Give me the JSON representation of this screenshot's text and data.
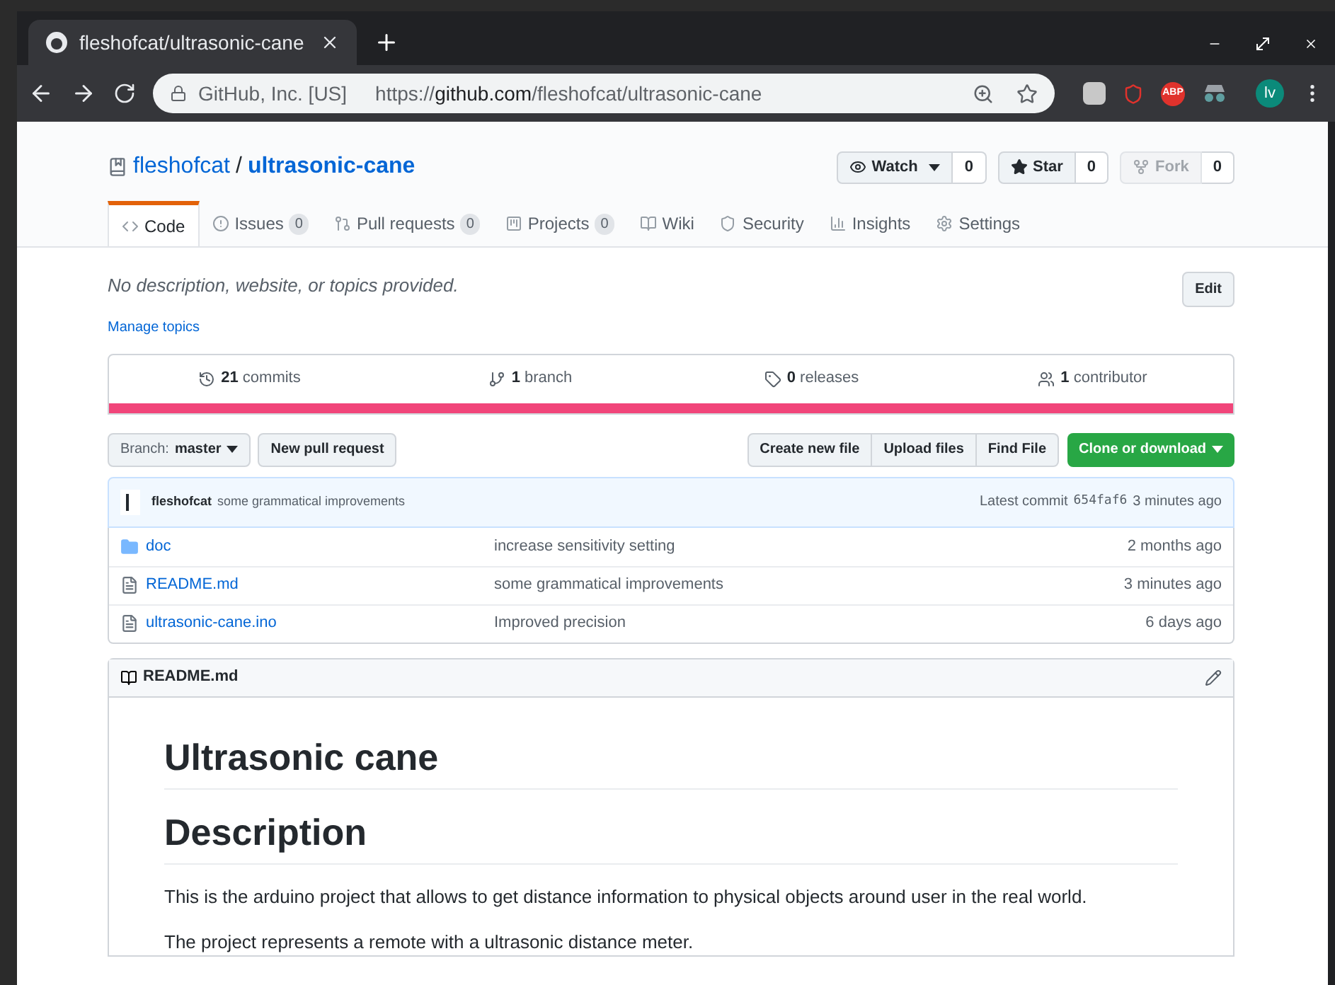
{
  "browser": {
    "tab_title": "fleshofcat/ultrasonic-cane",
    "site_identity": "GitHub, Inc. [US]",
    "url_scheme": "https://",
    "url_host": "github.com",
    "url_path": "/fleshofcat/ultrasonic-cane",
    "extension_badge": "ABP",
    "profile_initials": "lv"
  },
  "repo": {
    "owner": "fleshofcat",
    "separator": "/",
    "name": "ultrasonic-cane"
  },
  "actions": [
    {
      "label": "Watch",
      "count": "0",
      "kind": "watch",
      "disabled": false
    },
    {
      "label": "Star",
      "count": "0",
      "kind": "star",
      "disabled": false
    },
    {
      "label": "Fork",
      "count": "0",
      "kind": "fork",
      "disabled": true
    }
  ],
  "tabs": [
    {
      "label": "Code",
      "kind": "code",
      "selected": true
    },
    {
      "label": "Issues",
      "count": "0",
      "kind": "issues",
      "selected": false
    },
    {
      "label": "Pull requests",
      "count": "0",
      "kind": "pulls",
      "selected": false
    },
    {
      "label": "Projects",
      "count": "0",
      "kind": "projects",
      "selected": false
    },
    {
      "label": "Wiki",
      "kind": "wiki",
      "selected": false
    },
    {
      "label": "Security",
      "kind": "security",
      "selected": false
    },
    {
      "label": "Insights",
      "kind": "insights",
      "selected": false
    },
    {
      "label": "Settings",
      "kind": "settings",
      "selected": false
    }
  ],
  "description": "No description, website, or topics provided.",
  "edit_button": "Edit",
  "manage_topics": "Manage topics",
  "summary": [
    {
      "number": "21",
      "label": "commits",
      "kind": "commits"
    },
    {
      "number": "1",
      "label": "branch",
      "kind": "branch"
    },
    {
      "number": "0",
      "label": "releases",
      "kind": "tag"
    },
    {
      "number": "1",
      "label": "contributor",
      "kind": "people"
    }
  ],
  "branch": {
    "prefix": "Branch:",
    "name": "master"
  },
  "new_pull_request": "New pull request",
  "file_buttons": [
    "Create new file",
    "Upload files",
    "Find File"
  ],
  "clone_button": "Clone or download",
  "latest_commit": {
    "author": "fleshofcat",
    "message": "some grammatical improvements",
    "prefix": "Latest commit",
    "sha": "654faf6",
    "age": "3 minutes ago"
  },
  "files": [
    {
      "name": "doc",
      "kind": "folder",
      "message": "increase sensitivity setting",
      "age": "2 months ago"
    },
    {
      "name": "README.md",
      "kind": "file",
      "message": "some grammatical improvements",
      "age": "3 minutes ago"
    },
    {
      "name": "ultrasonic-cane.ino",
      "kind": "file",
      "message": "Improved precision",
      "age": "6 days ago"
    }
  ],
  "readme": {
    "title": "README.md",
    "h1": "Ultrasonic cane",
    "h2": "Description",
    "paragraphs": [
      "This is the arduino project that allows to get distance information to physical objects around user in the real world.",
      "The project represents a remote with a ultrasonic distance meter."
    ]
  }
}
